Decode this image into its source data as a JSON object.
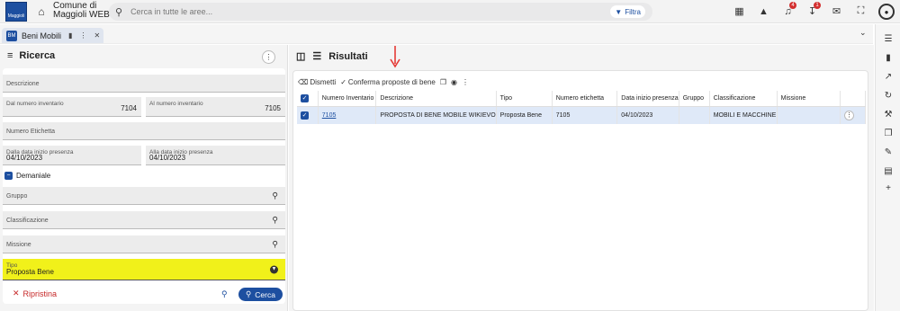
{
  "app": {
    "logo_text": "Maggioli",
    "brand_line1": "Comune di",
    "brand_line2": "Maggioli WEB",
    "search_placeholder": "Cerca in tutte le aree...",
    "filter_label": "Filtra",
    "notifications_count": "4",
    "downloads_count": "1"
  },
  "tab": {
    "icon_text": "BM",
    "label": "Beni Mobili"
  },
  "left": {
    "title": "Ricerca",
    "fields": {
      "descrizione_label": "Descrizione",
      "dal_inv_label": "Dal numero inventario",
      "dal_inv_value": "7104",
      "al_inv_label": "Al numero inventario",
      "al_inv_value": "7105",
      "etichetta_label": "Numero Etichetta",
      "dalla_data_label": "Dalla data inizio presenza",
      "dalla_data_value": "04/10/2023",
      "alla_data_label": "Alla data inizio presenza",
      "alla_data_value": "04/10/2023",
      "demaniale_label": "Demaniale",
      "gruppo_label": "Gruppo",
      "classificazione_label": "Classificazione",
      "missione_label": "Missione",
      "tipo_label": "Tipo",
      "tipo_value": "Proposta Bene"
    },
    "reset_label": "Ripristina",
    "search_label": "Cerca"
  },
  "right": {
    "title": "Risultati",
    "toolbar": {
      "dismetti": "Dismetti",
      "conferma": "Conferma proposte di bene"
    },
    "columns": [
      "Numero Inventario",
      "Descrizione",
      "Tipo",
      "Numero etichetta",
      "Data inizio presenza",
      "Gruppo",
      "Classificazione",
      "Missione"
    ],
    "rows": [
      {
        "numero_inventario": "7105",
        "descrizione": "PROPOSTA DI BENE MOBILE WIKIEVO",
        "tipo": "Proposta Bene",
        "numero_etichetta": "7105",
        "data_inizio": "04/10/2023",
        "gruppo": "",
        "classificazione": "MOBILI E MACCHINE",
        "missione": ""
      }
    ]
  },
  "colors": {
    "accent": "#1d4fa0",
    "highlight": "#f1f11a",
    "row_selected": "#dfe9f8",
    "reset": "#c62828",
    "annotation_arrow": "#e53935"
  }
}
